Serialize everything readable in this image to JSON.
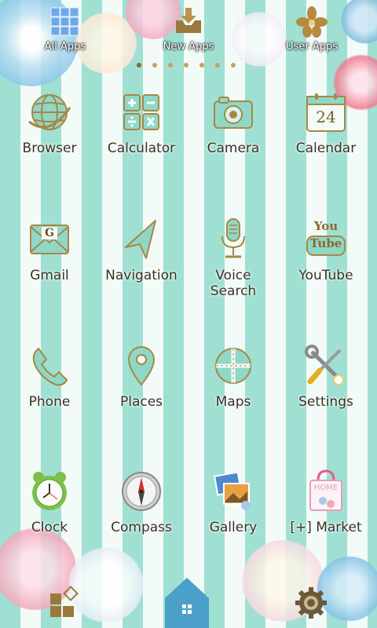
{
  "top_bar": {
    "all_apps": "All Apps",
    "new_apps": "New Apps",
    "user_apps": "User Apps"
  },
  "page_indicator": {
    "count": 7,
    "active_index": 0
  },
  "apps": [
    {
      "label": "Browser",
      "icon": "globe-icon"
    },
    {
      "label": "Calculator",
      "icon": "calculator-icon"
    },
    {
      "label": "Camera",
      "icon": "camera-icon"
    },
    {
      "label": "Calendar",
      "icon": "calendar-icon",
      "icon_text": "24"
    },
    {
      "label": "Gmail",
      "icon": "envelope-icon",
      "icon_text": "G"
    },
    {
      "label": "Navigation",
      "icon": "navigation-arrow-icon"
    },
    {
      "label": "Voice\nSearch",
      "icon": "microphone-icon"
    },
    {
      "label": "YouTube",
      "icon": "youtube-icon",
      "icon_text": "You Tube"
    },
    {
      "label": "Phone",
      "icon": "phone-handset-icon"
    },
    {
      "label": "Places",
      "icon": "map-pin-icon"
    },
    {
      "label": "Maps",
      "icon": "map-icon"
    },
    {
      "label": "Settings",
      "icon": "tools-icon"
    },
    {
      "label": "Clock",
      "icon": "alarm-clock-icon"
    },
    {
      "label": "Compass",
      "icon": "compass-icon"
    },
    {
      "label": "Gallery",
      "icon": "photos-icon"
    },
    {
      "label": "[+] Market",
      "icon": "shopping-bag-icon",
      "icon_text": "HOME"
    }
  ],
  "dock": {
    "left": "widgets-icon",
    "center": "home-icon",
    "right": "gear-icon"
  },
  "colors": {
    "stripe_mint": "#9fe0d2",
    "stripe_white": "#f2fbf8",
    "icon_teal": "#8fd8c8",
    "icon_gold": "#a88744",
    "label_text": "#3a3026"
  }
}
